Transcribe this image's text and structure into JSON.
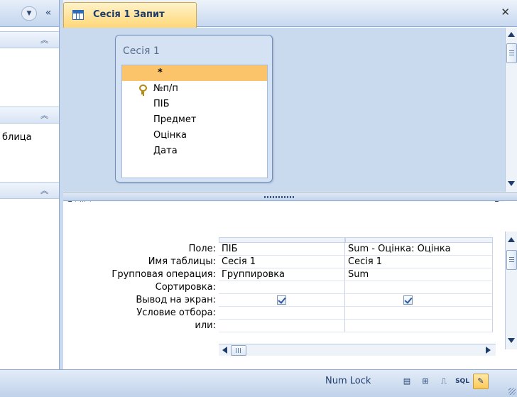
{
  "navigation": {
    "partial_item": "блица"
  },
  "document": {
    "tab_title": "Сесія 1 Запит"
  },
  "field_list": {
    "title": "Сесія 1",
    "fields": [
      "*",
      "№п/п",
      "ПІБ",
      "Предмет",
      "Оцінка",
      "Дата"
    ]
  },
  "grid": {
    "row_labels": [
      "Поле:",
      "Имя таблицы:",
      "Групповая операция:",
      "Сортировка:",
      "Вывод на экран:",
      "Условие отбора:",
      "или:"
    ],
    "columns": [
      {
        "field": "ПІБ",
        "table": "Сесія 1",
        "group": "Группировка",
        "sort": "",
        "show": true,
        "criteria": "",
        "or": ""
      },
      {
        "field": "Sum - Оцінка: Оцінка",
        "table": "Сесія 1",
        "group": "Sum",
        "sort": "",
        "show": true,
        "criteria": "",
        "or": ""
      }
    ]
  },
  "statusbar": {
    "num_lock": "Num Lock",
    "view_buttons": [
      "datasheet-view",
      "pivot-table-view",
      "pivot-chart-view",
      "SQL",
      "design-view"
    ],
    "active_view": "design-view"
  },
  "colors": {
    "accent": "#ffd778",
    "selection": "#fbc46a",
    "chrome": "#c9d9ee",
    "text_dark": "#1f3d6c"
  }
}
